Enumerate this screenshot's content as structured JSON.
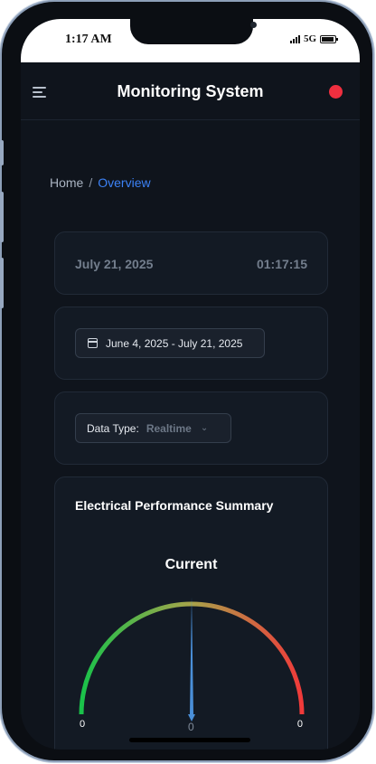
{
  "status_bar": {
    "time": "1:17 AM",
    "network": "5G"
  },
  "header": {
    "title": "Monitoring System",
    "status_color": "#ef2f3f"
  },
  "breadcrumb": {
    "home": "Home",
    "separator": "/",
    "current": "Overview"
  },
  "datetime": {
    "date": "July 21, 2025",
    "time": "01:17:15"
  },
  "date_range": {
    "label": "June 4, 2025 - July 21, 2025"
  },
  "data_type": {
    "label": "Data Type:",
    "value": "Realtime"
  },
  "summary": {
    "title": "Electrical Performance Summary",
    "gauge": {
      "title": "Current",
      "min": "0",
      "max": "0",
      "value": "0",
      "needle_color": "#4a8fd8",
      "arc_colors": [
        "#19c24a",
        "#a8a34a",
        "#f03a3a"
      ]
    }
  },
  "colors": {
    "accent": "#3c82f6",
    "background": "#0f141c",
    "card": "#131a24"
  }
}
